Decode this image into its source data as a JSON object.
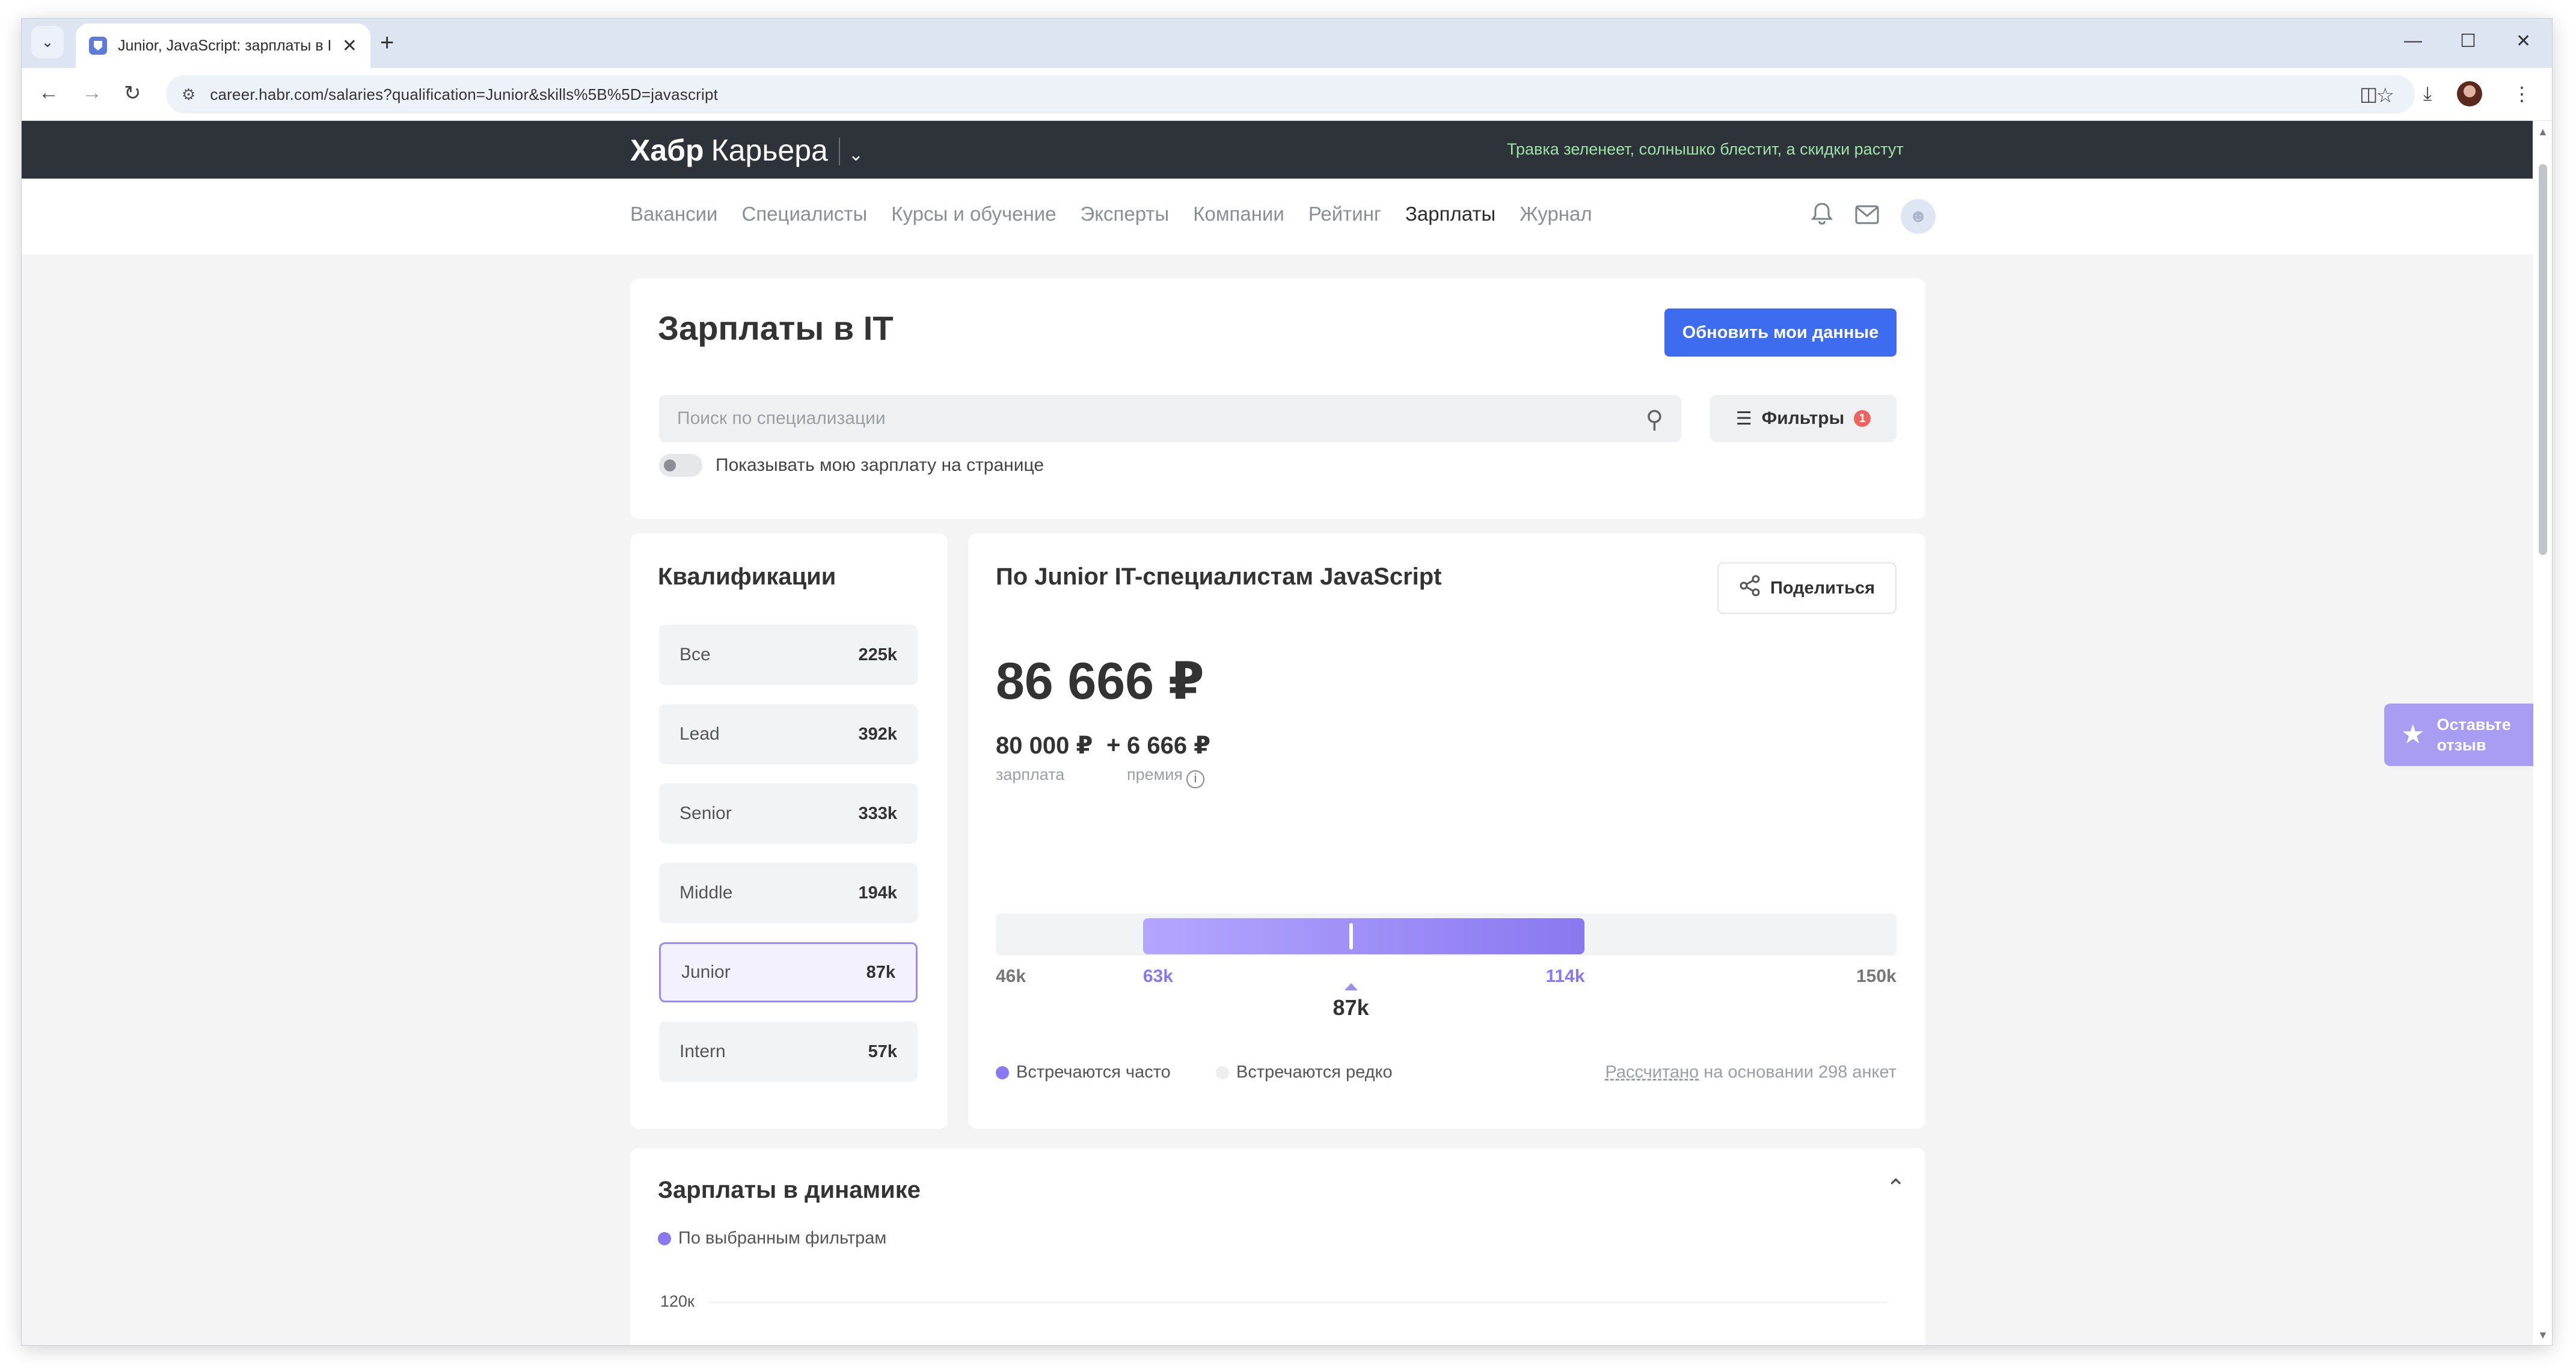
{
  "browser": {
    "tab_title": "Junior, JavaScript: зарплаты в I",
    "new_tab": "+",
    "url": "career.habr.com/salaries?qualification=Junior&skills%5B%5D=javascript"
  },
  "site": {
    "logo_bold": "Хабр",
    "logo_sub": "Карьера",
    "promo": "Травка зеленеет, солнышко блестит, а скидки растут",
    "nav": [
      "Вакансии",
      "Специалисты",
      "Курсы и обучение",
      "Эксперты",
      "Компании",
      "Рейтинг",
      "Зарплаты",
      "Журнал"
    ],
    "active_nav": "Зарплаты"
  },
  "header_card": {
    "title": "Зарплаты в IT",
    "update_button": "Обновить мои данные",
    "search_placeholder": "Поиск по специализации",
    "filters_button": "Фильтры",
    "filters_count": "1",
    "toggle_label": "Показывать мою зарплату на странице"
  },
  "qualifications": {
    "title": "Квалификации",
    "items": [
      {
        "label": "Все",
        "value": "225k"
      },
      {
        "label": "Lead",
        "value": "392k"
      },
      {
        "label": "Senior",
        "value": "333k"
      },
      {
        "label": "Middle",
        "value": "194k"
      },
      {
        "label": "Junior",
        "value": "87k"
      },
      {
        "label": "Intern",
        "value": "57k"
      }
    ],
    "selected": "Junior"
  },
  "salary": {
    "title": "По Junior IT-специалистам JavaScript",
    "share_button": "Поделиться",
    "total": "86 666 ₽",
    "salary_part": "80 000 ₽",
    "plus": "+",
    "bonus_part": "6 666 ₽",
    "salary_label": "зарплата",
    "bonus_label": "премия",
    "scale": {
      "min_label": "46k",
      "q1_label": "63k",
      "q3_label": "114k",
      "max_label": "150k",
      "median_label": "87k",
      "min": 46,
      "q1": 63,
      "median": 87,
      "q3": 114,
      "max": 150
    },
    "legend_often": "Встречаются часто",
    "legend_rare": "Встречаются редко",
    "footnote_link": "Рассчитано",
    "footnote_text": " на основании 298 анкет"
  },
  "dynamics": {
    "title": "Зарплаты в динамике",
    "legend": "По выбранным фильтрам",
    "y_label": "120к"
  },
  "feedback": {
    "line1": "Оставьте",
    "line2": "отзыв"
  },
  "colors": {
    "accent": "#3d6cf0",
    "range": "#8a78f0",
    "header_dark": "#2d3338",
    "promo": "#9be3a6"
  }
}
